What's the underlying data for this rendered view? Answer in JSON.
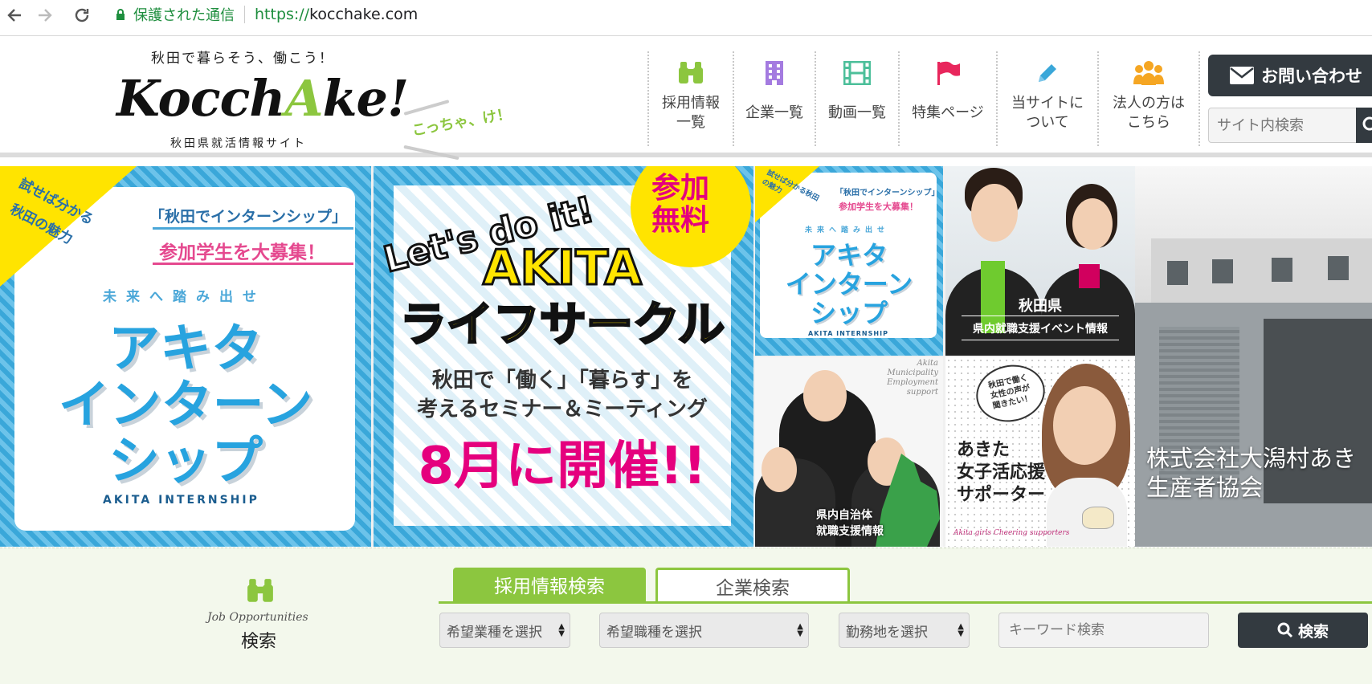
{
  "browser": {
    "secure_text": "保護された通信",
    "url_scheme": "https://",
    "url_host": "kocchake.com"
  },
  "header": {
    "tagline": "秋田で暮らそう、働こう！",
    "logo_main": "Kocch",
    "logo_accent": "A",
    "logo_end": "ke!",
    "logo_kotcha": "こっちゃ、け！",
    "logo_sub": "秋田県就活情報サイト",
    "nav": [
      {
        "label": "採用情報\n一覧",
        "icon": "binoculars-icon",
        "color": "#8cc63f"
      },
      {
        "label": "企業一覧",
        "icon": "building-icon",
        "color": "#a47be0"
      },
      {
        "label": "動画一覧",
        "icon": "film-icon",
        "color": "#4cbf9a"
      },
      {
        "label": "特集ページ",
        "icon": "flag-icon",
        "color": "#e8265c"
      },
      {
        "label": "当サイトに\nついて",
        "icon": "pencil-icon",
        "color": "#3aa7d9"
      },
      {
        "label": "法人の方は\nこちら",
        "icon": "people-icon",
        "color": "#f5a623"
      }
    ],
    "contact_label": "お問い合わせ",
    "search_placeholder": "サイト内検索"
  },
  "banners": {
    "internship_large": {
      "corner_line1": "試せば分かる",
      "corner_line2": "秋田の魅力",
      "line1": "「秋田でインターンシップ」",
      "line2": "参加学生を大募集！",
      "future": "未来へ踏み出せ",
      "title1": "アキタ",
      "title2": "インターン",
      "title3": "シップ",
      "en": "AKITA INTERNSHIP"
    },
    "life_circle": {
      "badge_line1": "参加",
      "badge_line2": "無料",
      "lets": "Let's do it!",
      "akita": "AKITA",
      "title": "ライフサークル",
      "sub1": "秋田で「働く」「暮らす」を",
      "sub2": "考えるセミナー＆ミーティング",
      "date": "8月に開催!!"
    },
    "internship_small": {
      "corner": "試せば分かる秋田の魅力",
      "line1": "「秋田でインターンシップ」",
      "line2": "参加学生を大募集！",
      "future": "未来へ踏み出せ",
      "title1": "アキタ",
      "title2": "インターン",
      "title3": "シップ",
      "en": "AKITA INTERNSHIP"
    },
    "event_info": {
      "line1": "秋田県",
      "line2": "県内就職支援イベント情報"
    },
    "municipality": {
      "script1": "Akita",
      "script2": "Municipality",
      "script3": "Employment",
      "script4": "support",
      "line1": "県内自治体",
      "line2": "就職支援情報"
    },
    "joshi": {
      "bubble1": "秋田で働く",
      "bubble2": "女性の声が",
      "bubble3": "聞きたい！",
      "line1": "あきた",
      "line2": "女子活応援",
      "line3": "サポーター",
      "en": "Akita girls Cheering supporters"
    },
    "company_feature": {
      "caption1": "株式会社大潟村あき",
      "caption2": "生産者協会"
    }
  },
  "search": {
    "section_script": "Job Opportunities",
    "section_label": "検索",
    "tab_job": "採用情報検索",
    "tab_company": "企業検索",
    "select_industry": "希望業種を選択",
    "select_job": "希望職種を選択",
    "select_location": "勤務地を選択",
    "keyword_placeholder": "キーワード検索",
    "search_button": "検索"
  }
}
